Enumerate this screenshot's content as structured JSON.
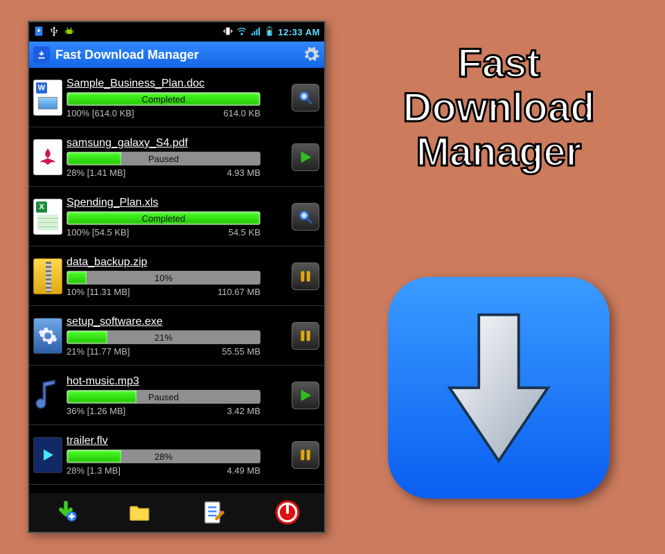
{
  "statusbar": {
    "time": "12:33 AM"
  },
  "header": {
    "title": "Fast Download Manager"
  },
  "downloads": [
    {
      "filename": "Sample_Business_Plan.doc",
      "status_label": "Completed",
      "progress_pct": 100,
      "stats_left": "100% [614.0 KB]",
      "stats_right": "614.0 KB",
      "file_kind": "doc",
      "action": "open"
    },
    {
      "filename": "samsung_galaxy_S4.pdf",
      "status_label": "Paused",
      "progress_pct": 28,
      "stats_left": "28% [1.41 MB]",
      "stats_right": "4.93 MB",
      "file_kind": "pdf",
      "action": "play"
    },
    {
      "filename": "Spending_Plan.xls",
      "status_label": "Completed",
      "progress_pct": 100,
      "stats_left": "100% [54.5 KB]",
      "stats_right": "54.5 KB",
      "file_kind": "xls",
      "action": "open"
    },
    {
      "filename": "data_backup.zip",
      "status_label": "10%",
      "progress_pct": 10,
      "stats_left": "10% [11.31 MB]",
      "stats_right": "110.67 MB",
      "file_kind": "zip",
      "action": "pause"
    },
    {
      "filename": "setup_software.exe",
      "status_label": "21%",
      "progress_pct": 21,
      "stats_left": "21% [11.77 MB]",
      "stats_right": "55.55 MB",
      "file_kind": "exe",
      "action": "pause"
    },
    {
      "filename": "hot-music.mp3",
      "status_label": "Paused",
      "progress_pct": 36,
      "stats_left": "36% [1.26 MB]",
      "stats_right": "3.42 MB",
      "file_kind": "mp3",
      "action": "play"
    },
    {
      "filename": "trailer.flv",
      "status_label": "28%",
      "progress_pct": 28,
      "stats_left": "28% [1.3 MB]",
      "stats_right": "4.49 MB",
      "file_kind": "flv",
      "action": "pause"
    }
  ],
  "promo": {
    "line1": "Fast",
    "line2": "Download",
    "line3": "Manager"
  }
}
